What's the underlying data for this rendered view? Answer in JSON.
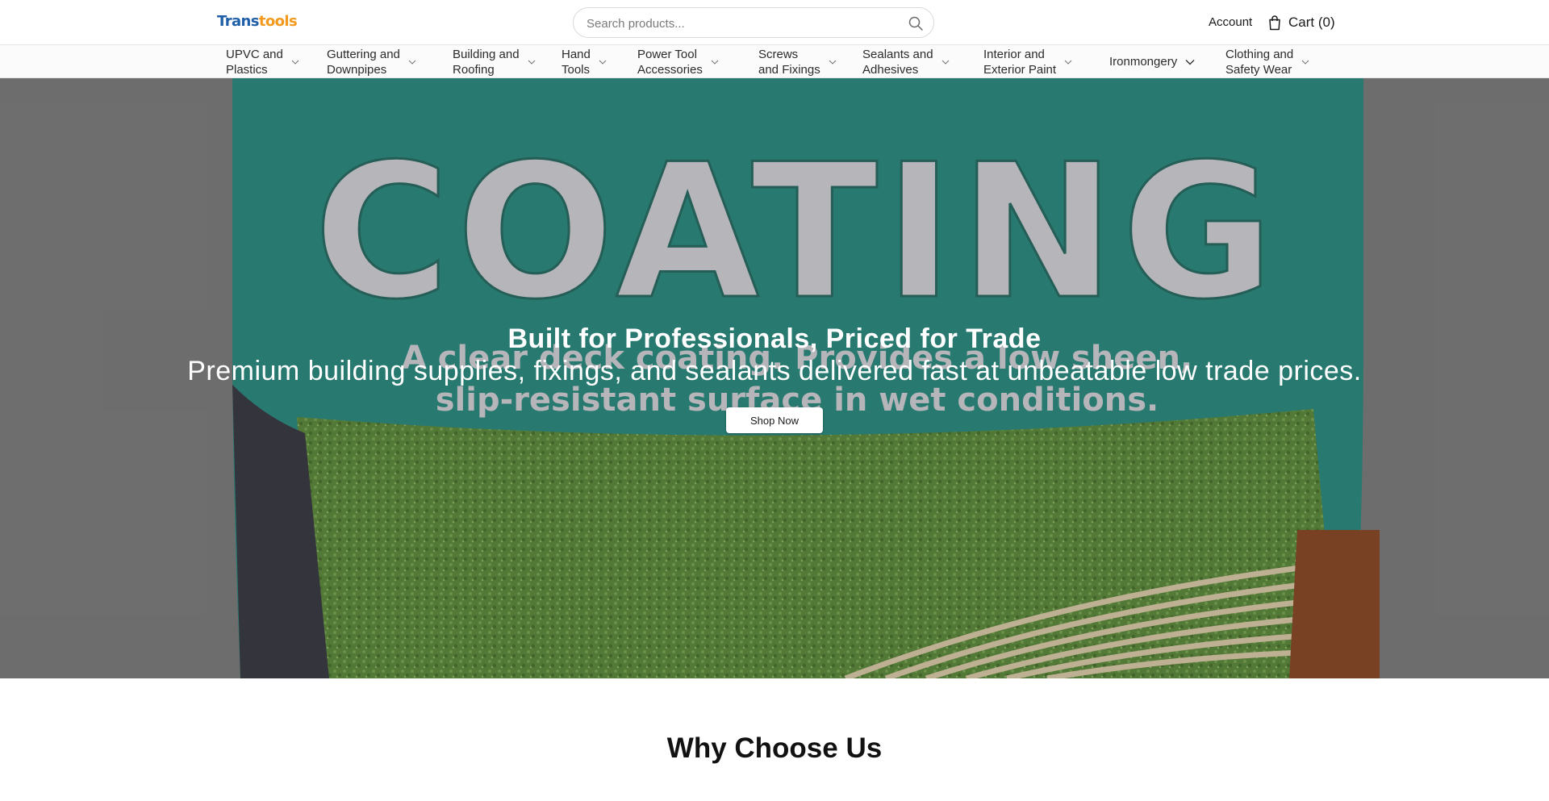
{
  "header": {
    "logo": {
      "part1": "Trans",
      "part2": "tools",
      "color1": "#1f5fa8",
      "color2": "#f39a1e"
    },
    "search": {
      "placeholder": "Search products...",
      "icon": "search-icon"
    },
    "account_label": "Account",
    "cart_label": "Cart (0)",
    "cart_icon": "shopping-bag-icon"
  },
  "nav": {
    "items": [
      {
        "label": "UPVC and\nPlastics"
      },
      {
        "label": "Guttering and\nDownpipes"
      },
      {
        "label": "Building and\nRoofing"
      },
      {
        "label": "Hand\nTools"
      },
      {
        "label": "Power Tool\nAccessories"
      },
      {
        "label": "Screws\nand Fixings"
      },
      {
        "label": "Sealants and\nAdhesives"
      },
      {
        "label": "Interior and\nExterior Paint"
      },
      {
        "label": "Ironmongery"
      },
      {
        "label": "Clothing and\nSafety Wear"
      }
    ]
  },
  "hero": {
    "title": "Built for Professionals, Priced for Trade",
    "subtitle": "Premium building supplies, fixings, and sealants delivered fast at unbeatable low trade prices.",
    "cta_label": "Shop Now",
    "image": {
      "brand_word": "COATING",
      "tagline_line1": "A clear deck coating. Provides a low sheen,",
      "tagline_line2": "slip-resistant surface in wet conditions.",
      "tin_color": "#2e8a80",
      "grit_color": "#5f8a3f"
    }
  },
  "section": {
    "why_title": "Why Choose Us"
  }
}
